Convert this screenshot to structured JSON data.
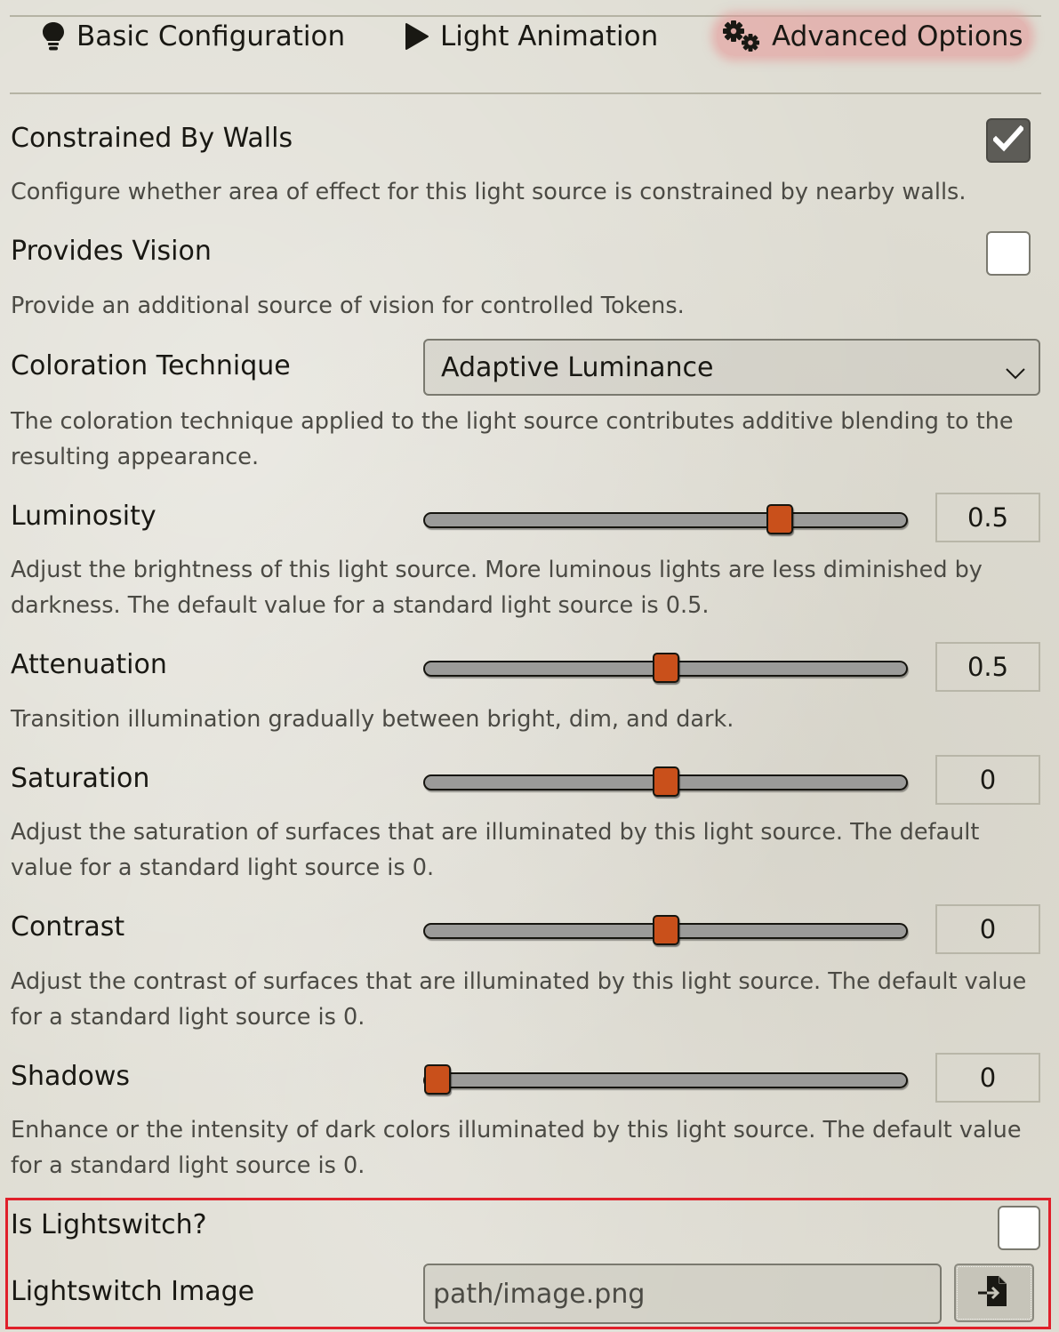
{
  "tabs": [
    {
      "label": "Basic Configuration",
      "icon": "lightbulb-icon",
      "active": false
    },
    {
      "label": "Light Animation",
      "icon": "play-icon",
      "active": false
    },
    {
      "label": "Advanced Options",
      "icon": "cogs-icon",
      "active": true
    }
  ],
  "fields": {
    "walls": {
      "label": "Constrained By Walls",
      "checked": true,
      "hint": "Configure whether area of effect for this light source is constrained by nearby walls."
    },
    "vision": {
      "label": "Provides Vision",
      "checked": false,
      "hint": "Provide an additional source of vision for controlled Tokens."
    },
    "coloration": {
      "label": "Coloration Technique",
      "selected": "Adaptive Luminance",
      "hint": "The coloration technique applied to the light source contributes additive blending to the resulting appearance."
    },
    "luminosity": {
      "label": "Luminosity",
      "value": "0.5",
      "min": -1,
      "max": 1,
      "numeric": 0.5,
      "hint": "Adjust the brightness of this light source. More luminous lights are less diminished by darkness. The default value for a standard light source is 0.5."
    },
    "attenuation": {
      "label": "Attenuation",
      "value": "0.5",
      "min": 0,
      "max": 1,
      "numeric": 0.5,
      "hint": "Transition illumination gradually between bright, dim, and dark."
    },
    "saturation": {
      "label": "Saturation",
      "value": "0",
      "min": -1,
      "max": 1,
      "numeric": 0,
      "hint": "Adjust the saturation of surfaces that are illuminated by this light source. The default value for a standard light source is 0."
    },
    "contrast": {
      "label": "Contrast",
      "value": "0",
      "min": -1,
      "max": 1,
      "numeric": 0,
      "hint": "Adjust the contrast of surfaces that are illuminated by this light source. The default value for a standard light source is 0."
    },
    "shadows": {
      "label": "Shadows",
      "value": "0",
      "min": 0,
      "max": 1,
      "numeric": 0,
      "hint": "Enhance or the intensity of dark colors illuminated by this light source. The default value for a standard light source is 0."
    },
    "lightswitch": {
      "label": "Is Lightswitch?",
      "checked": false
    },
    "lightswitch_image": {
      "label": "Lightswitch Image",
      "placeholder": "path/image.png",
      "button_icon": "file-import-icon"
    }
  },
  "colors": {
    "accent": "#c9501b",
    "highlight_border": "#e0202a",
    "active_tab_glow": "#e69696"
  }
}
